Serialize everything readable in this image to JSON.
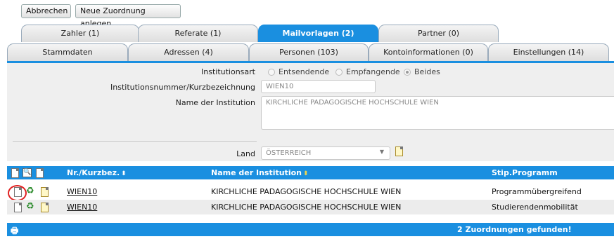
{
  "toolbar": {
    "cancel_label": "Abbrechen",
    "new_assignment_label": "Neue Zuordnung anlegen"
  },
  "tabs_row1": [
    {
      "label": "Zahler (1)",
      "active": false
    },
    {
      "label": "Referate (1)",
      "active": false
    },
    {
      "label": "Mailvorlagen (2)",
      "active": true
    },
    {
      "label": "Partner (0)",
      "active": false
    }
  ],
  "tabs_row2": [
    {
      "label": "Stammdaten"
    },
    {
      "label": "Adressen (4)"
    },
    {
      "label": "Personen (103)"
    },
    {
      "label": "Kontoinformationen (0)"
    },
    {
      "label": "Einstellungen (14)"
    }
  ],
  "form": {
    "institutionsart_label": "Institutionsart",
    "radio_options": [
      "Entsendende",
      "Empfangende",
      "Beides"
    ],
    "radio_selected": "Beides",
    "nr_label": "Institutionsnummer/Kurzbezeichnung",
    "nr_value": "WIEN10",
    "name_label": "Name der Institution",
    "name_value": "KIRCHLICHE PADAGOGISCHE HOCHSCHULE WIEN",
    "land_label": "Land",
    "land_value": "ÖSTERREICH"
  },
  "table": {
    "columns": [
      "Nr./Kurzbez.",
      "Name der Institution",
      "Stip.Programm"
    ],
    "rows": [
      {
        "nr": "WIEN10",
        "name": "KIRCHLICHE PADAGOGISCHE HOCHSCHULE WIEN",
        "programm": "Programmübergreifend"
      },
      {
        "nr": "WIEN10",
        "name": "KIRCHLICHE PADAGOGISCHE HOCHSCHULE WIEN",
        "programm": "Studierendenmobilität"
      }
    ],
    "footer_count": "2 Zuordnungen gefunden!"
  },
  "colors": {
    "accent": "#1a8fe0",
    "row_alt": "#ececec",
    "annotation": "#e02020"
  }
}
